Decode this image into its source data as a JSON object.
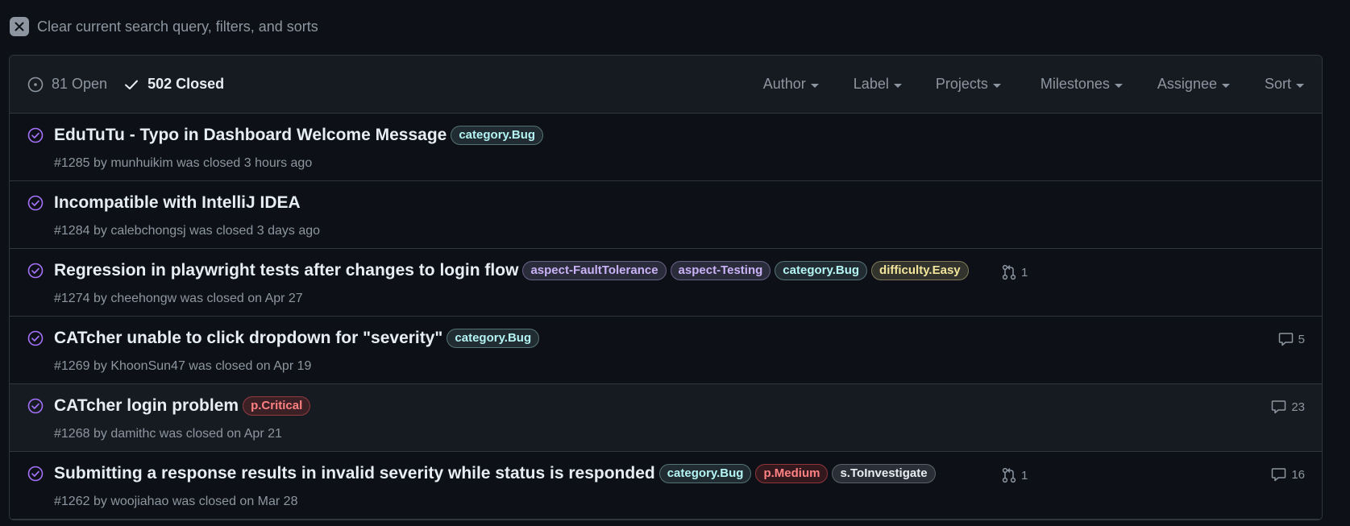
{
  "clear": {
    "label": "Clear current search query, filters, and sorts"
  },
  "states": {
    "open_label": "81 Open",
    "closed_label": "502 Closed"
  },
  "filters": [
    "Author",
    "Label",
    "Projects",
    "Milestones",
    "Assignee",
    "Sort"
  ],
  "colors": {
    "closed_icon": "#a371f7",
    "label_bug": "#b4f4f4",
    "label_fault": "#cab2f6",
    "label_easy": "#f2e49b",
    "label_critical": "#ff8181"
  },
  "issues": [
    {
      "title": "EduTuTu - Typo in Dashboard Welcome Message",
      "labels": [
        {
          "text": "category.Bug",
          "kind": "bug"
        }
      ],
      "number": "#1285",
      "by": "by",
      "author": "munhuikim",
      "closed_text": "was closed 3 hours ago",
      "linked_prs": "",
      "comments": ""
    },
    {
      "title": "Incompatible with IntelliJ IDEA",
      "labels": [],
      "number": "#1284",
      "by": "by",
      "author": "calebchongsj",
      "closed_text": "was closed 3 days ago",
      "linked_prs": "",
      "comments": ""
    },
    {
      "title": "Regression in playwright tests after changes to login flow",
      "labels": [
        {
          "text": "aspect-FaultTolerance",
          "kind": "aspect"
        },
        {
          "text": "aspect-Testing",
          "kind": "aspect"
        },
        {
          "text": "category.Bug",
          "kind": "bug"
        },
        {
          "text": "difficulty.Easy",
          "kind": "easy"
        }
      ],
      "number": "#1274",
      "by": "by",
      "author": "cheehongw",
      "closed_text": "was closed on Apr 27",
      "linked_prs": "1",
      "comments": ""
    },
    {
      "title": "CATcher unable to click dropdown for \"severity\"",
      "labels": [
        {
          "text": "category.Bug",
          "kind": "bug"
        }
      ],
      "number": "#1269",
      "by": "by",
      "author": "KhoonSun47",
      "closed_text": "was closed on Apr 19",
      "linked_prs": "",
      "comments": "5"
    },
    {
      "title": "CATcher login problem",
      "labels": [
        {
          "text": "p.Critical",
          "kind": "critical"
        }
      ],
      "number": "#1268",
      "by": "by",
      "author": "damithc",
      "closed_text": "was closed on Apr 21",
      "linked_prs": "",
      "comments": "23"
    },
    {
      "title": "Submitting a response results in invalid severity while status is responded",
      "labels": [
        {
          "text": "category.Bug",
          "kind": "bug"
        },
        {
          "text": "p.Medium",
          "kind": "critical"
        },
        {
          "text": "s.ToInvestigate",
          "kind": "neutral"
        }
      ],
      "number": "#1262",
      "by": "by",
      "author": "woojiahao",
      "closed_text": "was closed on Mar 28",
      "linked_prs": "1",
      "comments": "16"
    }
  ]
}
